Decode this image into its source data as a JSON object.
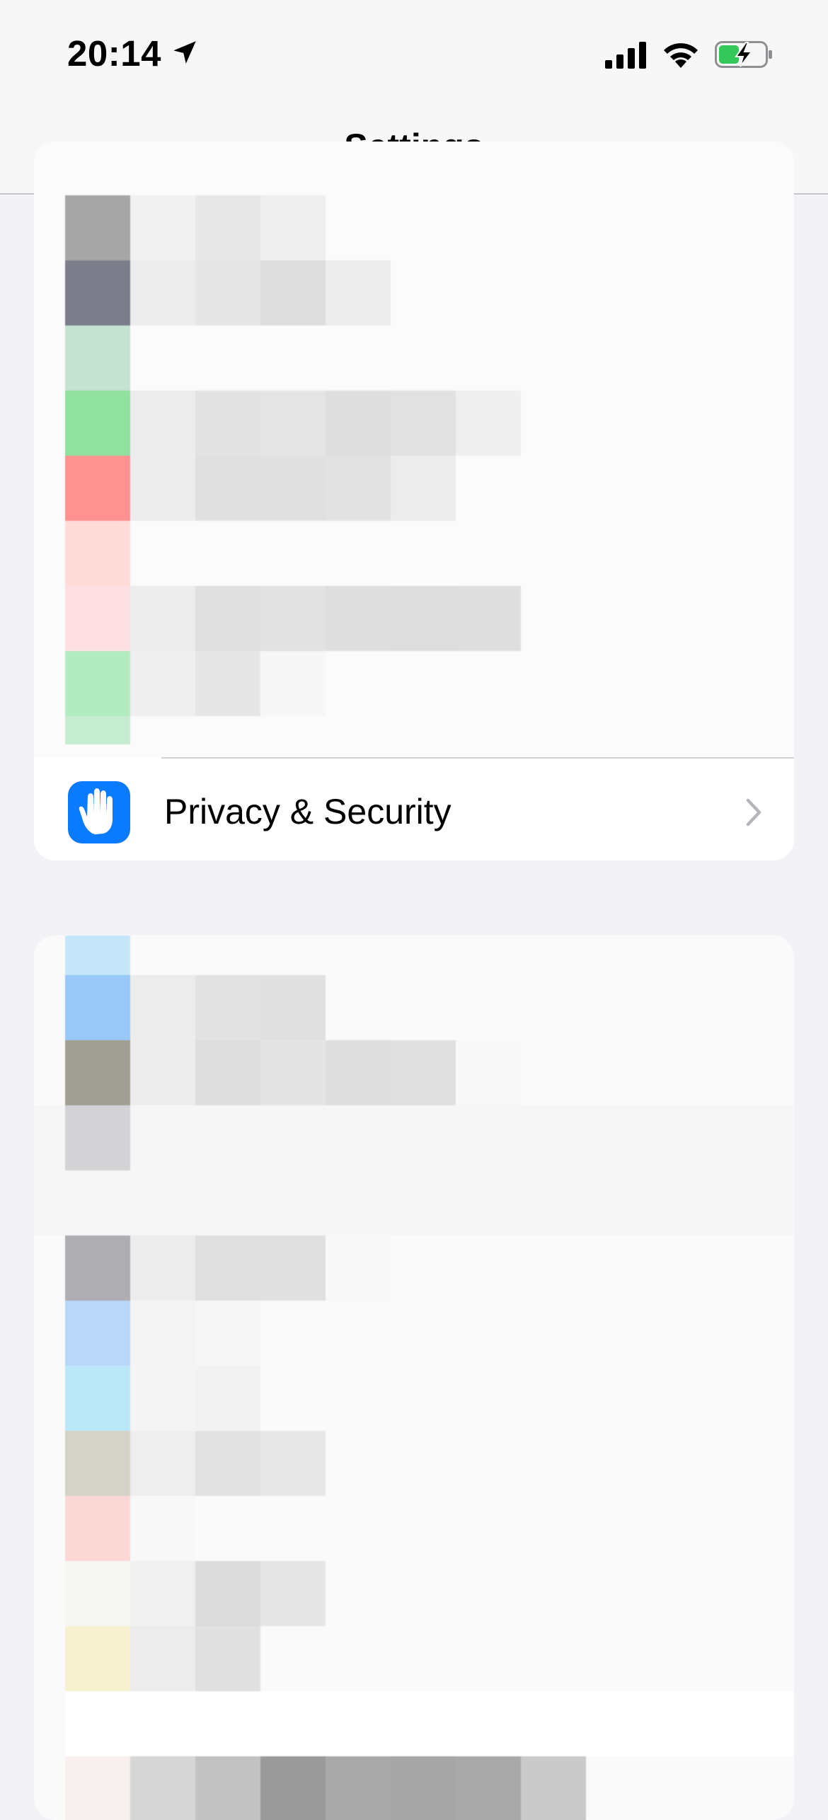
{
  "status_bar": {
    "time": "20:14",
    "icons": [
      "location-arrow-icon",
      "cellular-signal-icon",
      "wifi-icon",
      "battery-charging-icon"
    ],
    "battery_color": "#34c759"
  },
  "nav": {
    "title": "Settings"
  },
  "group_1": {
    "rows": [
      {
        "label": "Privacy & Security",
        "icon": "hand-icon",
        "icon_color": "#0a7aff"
      }
    ]
  },
  "colors": {
    "background": "#f2f2f7",
    "accent": "#0a7aff",
    "divider": "#d1d1d6"
  }
}
